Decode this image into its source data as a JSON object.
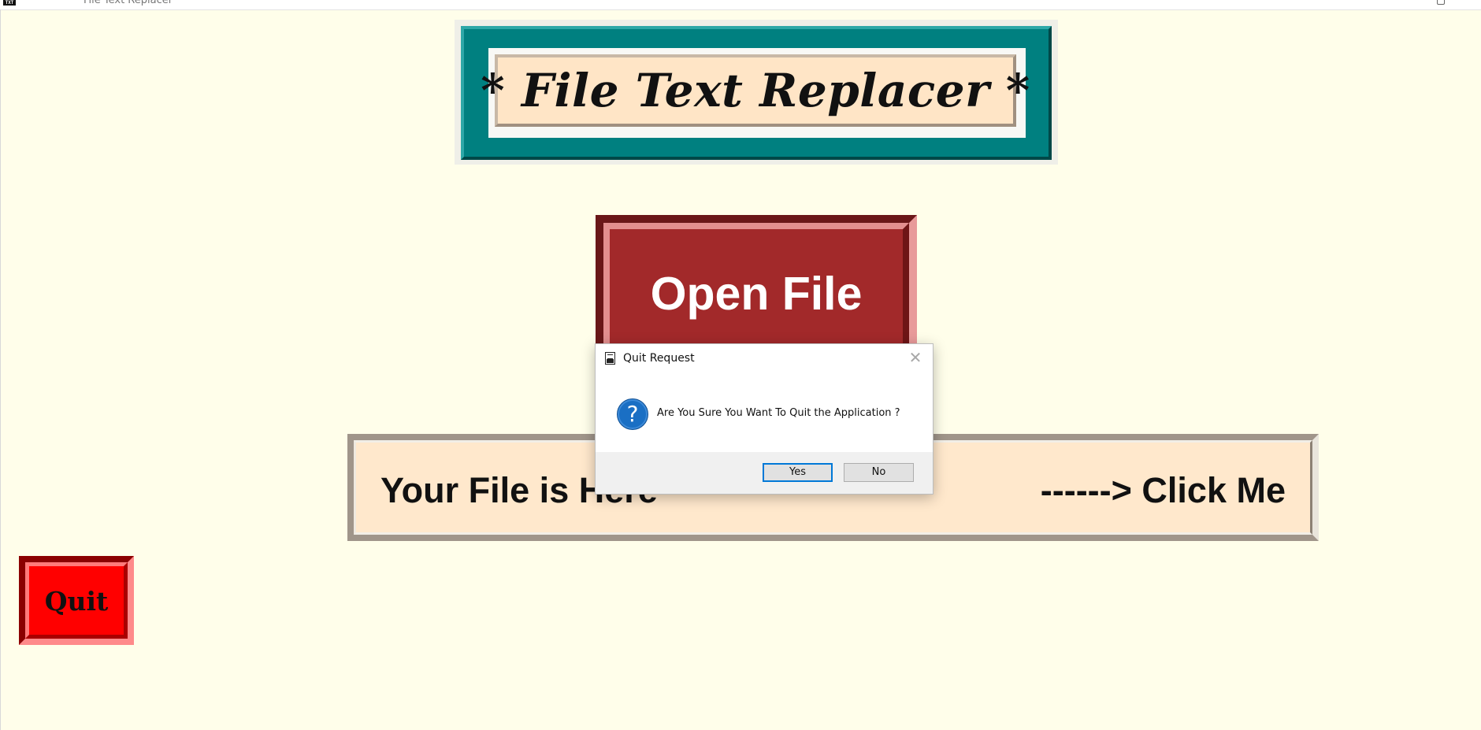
{
  "window": {
    "title": "File Text Replacer",
    "icon_label": "TXT"
  },
  "banner": {
    "title": "* File Text Replacer *"
  },
  "open_button": {
    "label": "Open File"
  },
  "file_bar": {
    "path_text": "Your File is Here",
    "click_text": "------> Click Me"
  },
  "quit_button": {
    "label": "Quit"
  },
  "dialog": {
    "title": "Quit Request",
    "icon": "question-icon",
    "message": "Are You Sure You Want To Quit the Application  ?",
    "yes_label": "Yes",
    "no_label": "No",
    "close_glyph": "✕"
  },
  "colors": {
    "background": "#fffeea",
    "banner_teal": "#008080",
    "banner_inner": "#ffe5c6",
    "open_button": "#a2292a",
    "file_bar": "#ffe8cc",
    "quit_button": "#ff0000",
    "dialog_accent": "#0078d7"
  }
}
